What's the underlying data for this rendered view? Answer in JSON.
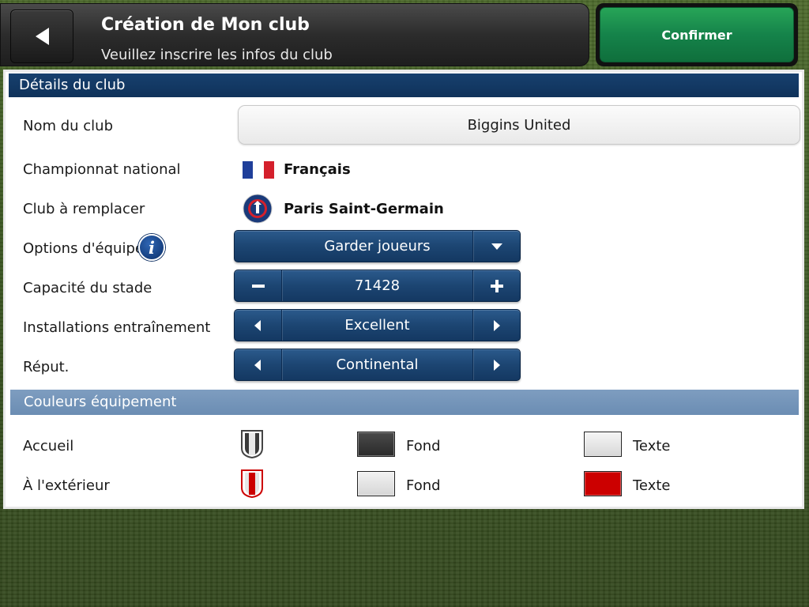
{
  "header": {
    "title": "Création de Mon club",
    "subtitle": "Veuillez inscrire les infos du club",
    "confirm_label": "Confirmer"
  },
  "club_details": {
    "section_title": "Détails du club",
    "name": {
      "label": "Nom du club",
      "value": "Biggins United"
    },
    "league": {
      "label": "Championnat national",
      "value": "Français"
    },
    "replace_club": {
      "label": "Club à remplacer",
      "value": "Paris Saint-Germain"
    },
    "team_options": {
      "label": "Options d'équipe",
      "value": "Garder joueurs"
    },
    "stadium_capacity": {
      "label": "Capacité du stade",
      "value": "71428"
    },
    "training_facilities": {
      "label": "Installations entraînement",
      "value": "Excellent"
    },
    "reputation": {
      "label": "Réput.",
      "value": "Continental"
    }
  },
  "kit_colors": {
    "section_title": "Couleurs équipement",
    "home": {
      "label": "Accueil",
      "background_label": "Fond",
      "text_label": "Texte",
      "background_color": "#3a3a3a",
      "text_color": "#e8e8e8"
    },
    "away": {
      "label": "À l'extérieur",
      "background_label": "Fond",
      "text_label": "Texte",
      "background_color": "#e6e6e6",
      "text_color": "#cc0000"
    }
  },
  "icons": {
    "back": "back-arrow-icon",
    "info": "info-icon",
    "dropdown": "chevron-down-icon",
    "minus": "minus-icon",
    "plus": "plus-icon",
    "left": "arrow-left-icon",
    "right": "arrow-right-icon"
  },
  "colors": {
    "section_dark": "#0f325a",
    "section_light": "#6b8db3",
    "confirm_green": "#15834a",
    "control_blue": "#1c4572"
  }
}
